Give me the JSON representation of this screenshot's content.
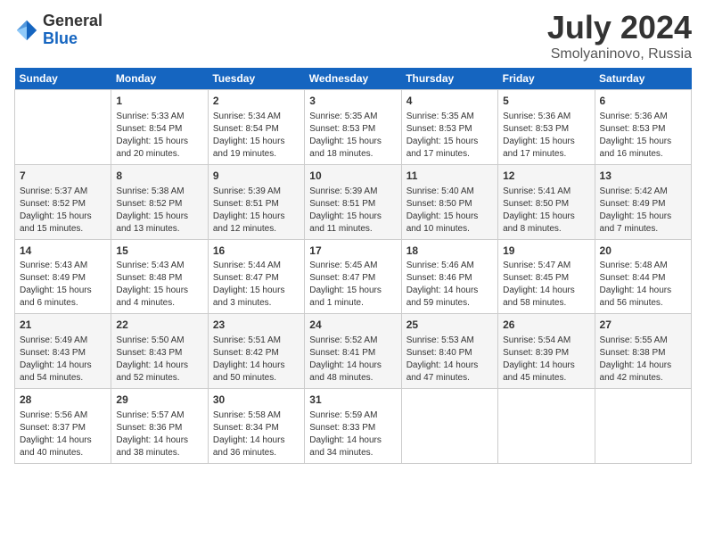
{
  "logo": {
    "general": "General",
    "blue": "Blue"
  },
  "title": "July 2024",
  "subtitle": "Smolyaninovo, Russia",
  "days_of_week": [
    "Sunday",
    "Monday",
    "Tuesday",
    "Wednesday",
    "Thursday",
    "Friday",
    "Saturday"
  ],
  "weeks": [
    [
      {
        "day": "",
        "info": ""
      },
      {
        "day": "1",
        "info": "Sunrise: 5:33 AM\nSunset: 8:54 PM\nDaylight: 15 hours\nand 20 minutes."
      },
      {
        "day": "2",
        "info": "Sunrise: 5:34 AM\nSunset: 8:54 PM\nDaylight: 15 hours\nand 19 minutes."
      },
      {
        "day": "3",
        "info": "Sunrise: 5:35 AM\nSunset: 8:53 PM\nDaylight: 15 hours\nand 18 minutes."
      },
      {
        "day": "4",
        "info": "Sunrise: 5:35 AM\nSunset: 8:53 PM\nDaylight: 15 hours\nand 17 minutes."
      },
      {
        "day": "5",
        "info": "Sunrise: 5:36 AM\nSunset: 8:53 PM\nDaylight: 15 hours\nand 17 minutes."
      },
      {
        "day": "6",
        "info": "Sunrise: 5:36 AM\nSunset: 8:53 PM\nDaylight: 15 hours\nand 16 minutes."
      }
    ],
    [
      {
        "day": "7",
        "info": "Sunrise: 5:37 AM\nSunset: 8:52 PM\nDaylight: 15 hours\nand 15 minutes."
      },
      {
        "day": "8",
        "info": "Sunrise: 5:38 AM\nSunset: 8:52 PM\nDaylight: 15 hours\nand 13 minutes."
      },
      {
        "day": "9",
        "info": "Sunrise: 5:39 AM\nSunset: 8:51 PM\nDaylight: 15 hours\nand 12 minutes."
      },
      {
        "day": "10",
        "info": "Sunrise: 5:39 AM\nSunset: 8:51 PM\nDaylight: 15 hours\nand 11 minutes."
      },
      {
        "day": "11",
        "info": "Sunrise: 5:40 AM\nSunset: 8:50 PM\nDaylight: 15 hours\nand 10 minutes."
      },
      {
        "day": "12",
        "info": "Sunrise: 5:41 AM\nSunset: 8:50 PM\nDaylight: 15 hours\nand 8 minutes."
      },
      {
        "day": "13",
        "info": "Sunrise: 5:42 AM\nSunset: 8:49 PM\nDaylight: 15 hours\nand 7 minutes."
      }
    ],
    [
      {
        "day": "14",
        "info": "Sunrise: 5:43 AM\nSunset: 8:49 PM\nDaylight: 15 hours\nand 6 minutes."
      },
      {
        "day": "15",
        "info": "Sunrise: 5:43 AM\nSunset: 8:48 PM\nDaylight: 15 hours\nand 4 minutes."
      },
      {
        "day": "16",
        "info": "Sunrise: 5:44 AM\nSunset: 8:47 PM\nDaylight: 15 hours\nand 3 minutes."
      },
      {
        "day": "17",
        "info": "Sunrise: 5:45 AM\nSunset: 8:47 PM\nDaylight: 15 hours\nand 1 minute."
      },
      {
        "day": "18",
        "info": "Sunrise: 5:46 AM\nSunset: 8:46 PM\nDaylight: 14 hours\nand 59 minutes."
      },
      {
        "day": "19",
        "info": "Sunrise: 5:47 AM\nSunset: 8:45 PM\nDaylight: 14 hours\nand 58 minutes."
      },
      {
        "day": "20",
        "info": "Sunrise: 5:48 AM\nSunset: 8:44 PM\nDaylight: 14 hours\nand 56 minutes."
      }
    ],
    [
      {
        "day": "21",
        "info": "Sunrise: 5:49 AM\nSunset: 8:43 PM\nDaylight: 14 hours\nand 54 minutes."
      },
      {
        "day": "22",
        "info": "Sunrise: 5:50 AM\nSunset: 8:43 PM\nDaylight: 14 hours\nand 52 minutes."
      },
      {
        "day": "23",
        "info": "Sunrise: 5:51 AM\nSunset: 8:42 PM\nDaylight: 14 hours\nand 50 minutes."
      },
      {
        "day": "24",
        "info": "Sunrise: 5:52 AM\nSunset: 8:41 PM\nDaylight: 14 hours\nand 48 minutes."
      },
      {
        "day": "25",
        "info": "Sunrise: 5:53 AM\nSunset: 8:40 PM\nDaylight: 14 hours\nand 47 minutes."
      },
      {
        "day": "26",
        "info": "Sunrise: 5:54 AM\nSunset: 8:39 PM\nDaylight: 14 hours\nand 45 minutes."
      },
      {
        "day": "27",
        "info": "Sunrise: 5:55 AM\nSunset: 8:38 PM\nDaylight: 14 hours\nand 42 minutes."
      }
    ],
    [
      {
        "day": "28",
        "info": "Sunrise: 5:56 AM\nSunset: 8:37 PM\nDaylight: 14 hours\nand 40 minutes."
      },
      {
        "day": "29",
        "info": "Sunrise: 5:57 AM\nSunset: 8:36 PM\nDaylight: 14 hours\nand 38 minutes."
      },
      {
        "day": "30",
        "info": "Sunrise: 5:58 AM\nSunset: 8:34 PM\nDaylight: 14 hours\nand 36 minutes."
      },
      {
        "day": "31",
        "info": "Sunrise: 5:59 AM\nSunset: 8:33 PM\nDaylight: 14 hours\nand 34 minutes."
      },
      {
        "day": "",
        "info": ""
      },
      {
        "day": "",
        "info": ""
      },
      {
        "day": "",
        "info": ""
      }
    ]
  ]
}
